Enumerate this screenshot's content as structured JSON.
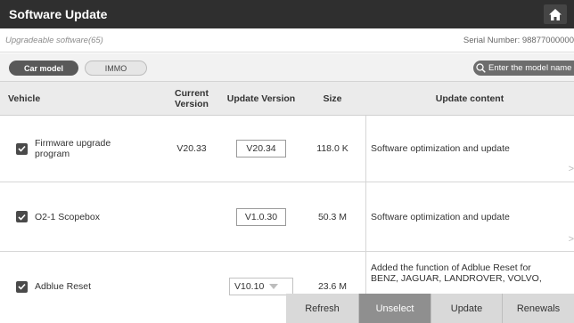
{
  "header": {
    "title": "Software Update",
    "home_icon": "home-icon"
  },
  "info": {
    "upgradeable": "Upgradeable software(65)",
    "serial": "Serial Number:  98877000000"
  },
  "tabs": [
    {
      "label": "Car model",
      "active": true
    },
    {
      "label": "IMMO",
      "active": false
    }
  ],
  "search": {
    "placeholder": "Enter the model name",
    "icon": "search-icon"
  },
  "table": {
    "headers": {
      "vehicle": "Vehicle",
      "current": "Current\nVersion",
      "update": "Update Version",
      "size": "Size",
      "content": "Update content"
    },
    "rows": [
      {
        "vehicle": "Firmware upgrade\nprogram",
        "checked": true,
        "current": "V20.33",
        "update": "V20.34",
        "size": "118.0 K",
        "content": "Software optimization and update"
      },
      {
        "vehicle": "O2-1 Scopebox",
        "checked": true,
        "current": "",
        "update": "V1.0.30",
        "size": "50.3 M",
        "content": "Software optimization and update"
      },
      {
        "vehicle": "Adblue Reset",
        "checked": true,
        "current": "",
        "update": "V10.10",
        "size": "23.6 M",
        "content": "Added the function of Adblue Reset for\nBENZ, JAGUAR, LANDROVER, VOLVO,"
      }
    ]
  },
  "actions": {
    "refresh": "Refresh",
    "unselect": "Unselect",
    "update": "Update",
    "renewals": "Renewals"
  },
  "colors": {
    "title_bar": "#2f2f2f",
    "active_tab": "#595959",
    "active_button": "#8f8f8f"
  }
}
